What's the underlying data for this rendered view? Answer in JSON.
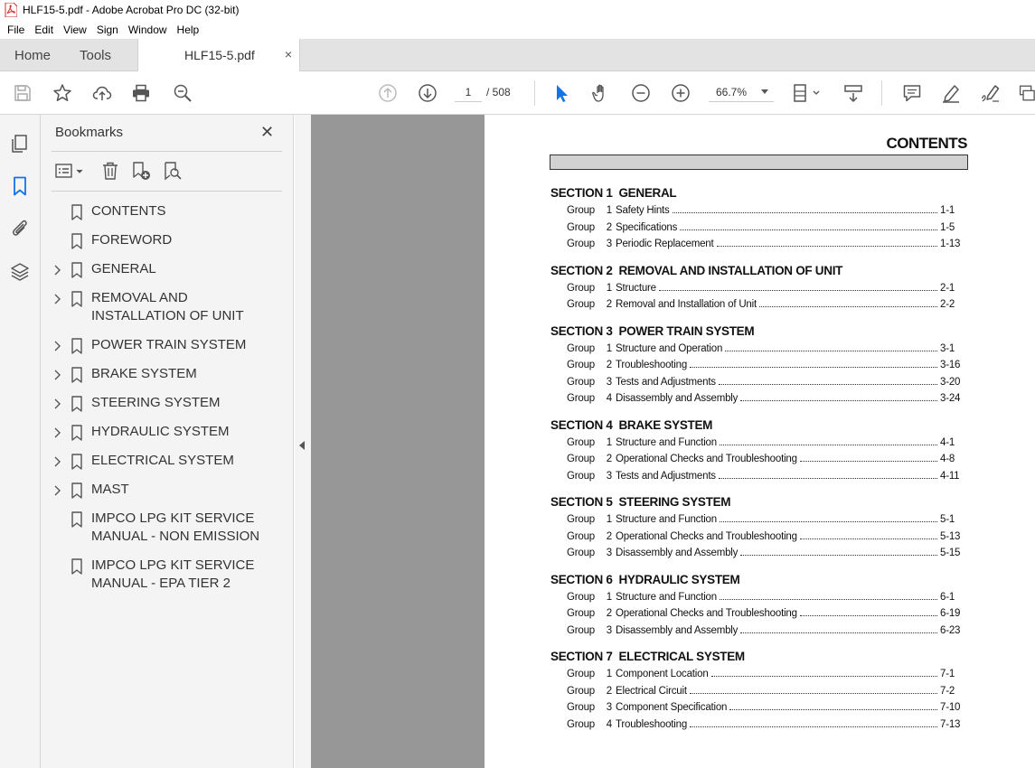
{
  "window": {
    "title": "HLF15-5.pdf - Adobe Acrobat Pro DC (32-bit)"
  },
  "menu": [
    "File",
    "Edit",
    "View",
    "Sign",
    "Window",
    "Help"
  ],
  "tabs": {
    "home": "Home",
    "tools": "Tools",
    "document": "HLF15-5.pdf",
    "close": "×"
  },
  "toolbar": {
    "page_current": "1",
    "page_total": "/ 508",
    "zoom": "66.7%"
  },
  "bookmarks": {
    "title": "Bookmarks",
    "close": "✕",
    "items": [
      {
        "label": "CONTENTS",
        "expandable": false
      },
      {
        "label": "FOREWORD",
        "expandable": false
      },
      {
        "label": "GENERAL",
        "expandable": true
      },
      {
        "label": "REMOVAL AND INSTALLATION OF UNIT",
        "expandable": true
      },
      {
        "label": "POWER TRAIN SYSTEM",
        "expandable": true
      },
      {
        "label": "BRAKE SYSTEM",
        "expandable": true
      },
      {
        "label": "STEERING SYSTEM",
        "expandable": true
      },
      {
        "label": "HYDRAULIC SYSTEM",
        "expandable": true
      },
      {
        "label": "ELECTRICAL SYSTEM",
        "expandable": true
      },
      {
        "label": "MAST",
        "expandable": true
      },
      {
        "label": "IMPCO LPG KIT SERVICE MANUAL - NON EMISSION",
        "expandable": false
      },
      {
        "label": "IMPCO LPG KIT SERVICE MANUAL - EPA TIER 2",
        "expandable": false
      }
    ]
  },
  "document": {
    "title": "CONTENTS",
    "sections": [
      {
        "heading": "SECTION 1  GENERAL",
        "groups": [
          {
            "group": "Group",
            "num": "1",
            "name": "Safety Hints",
            "page": "1-1"
          },
          {
            "group": "Group",
            "num": "2",
            "name": "Specifications",
            "page": "1-5"
          },
          {
            "group": "Group",
            "num": "3",
            "name": "Periodic Replacement",
            "page": "1-13"
          }
        ]
      },
      {
        "heading": "SECTION 2  REMOVAL AND INSTALLATION OF UNIT",
        "groups": [
          {
            "group": "Group",
            "num": "1",
            "name": "Structure",
            "page": "2-1"
          },
          {
            "group": "Group",
            "num": "2",
            "name": "Removal and Installation of Unit",
            "page": "2-2"
          }
        ]
      },
      {
        "heading": "SECTION 3  POWER TRAIN SYSTEM",
        "groups": [
          {
            "group": "Group",
            "num": "1",
            "name": "Structure and Operation",
            "page": "3-1"
          },
          {
            "group": "Group",
            "num": "2",
            "name": "Troubleshooting",
            "page": "3-16"
          },
          {
            "group": "Group",
            "num": "3",
            "name": "Tests and Adjustments",
            "page": "3-20"
          },
          {
            "group": "Group",
            "num": "4",
            "name": "Disassembly and Assembly",
            "page": "3-24"
          }
        ]
      },
      {
        "heading": "SECTION 4  BRAKE SYSTEM",
        "groups": [
          {
            "group": "Group",
            "num": "1",
            "name": "Structure and Function",
            "page": "4-1"
          },
          {
            "group": "Group",
            "num": "2",
            "name": "Operational Checks and Troubleshooting",
            "page": "4-8"
          },
          {
            "group": "Group",
            "num": "3",
            "name": "Tests and Adjustments",
            "page": "4-11"
          }
        ]
      },
      {
        "heading": "SECTION 5  STEERING SYSTEM",
        "groups": [
          {
            "group": "Group",
            "num": "1",
            "name": "Structure and Function",
            "page": "5-1"
          },
          {
            "group": "Group",
            "num": "2",
            "name": "Operational Checks and Troubleshooting",
            "page": "5-13"
          },
          {
            "group": "Group",
            "num": "3",
            "name": "Disassembly and Assembly",
            "page": "5-15"
          }
        ]
      },
      {
        "heading": "SECTION 6  HYDRAULIC SYSTEM",
        "groups": [
          {
            "group": "Group",
            "num": "1",
            "name": "Structure and Function",
            "page": "6-1"
          },
          {
            "group": "Group",
            "num": "2",
            "name": "Operational Checks and Troubleshooting",
            "page": "6-19"
          },
          {
            "group": "Group",
            "num": "3",
            "name": "Disassembly and Assembly",
            "page": "6-23"
          }
        ]
      },
      {
        "heading": "SECTION 7  ELECTRICAL SYSTEM",
        "groups": [
          {
            "group": "Group",
            "num": "1",
            "name": "Component Location",
            "page": "7-1"
          },
          {
            "group": "Group",
            "num": "2",
            "name": "Electrical Circuit",
            "page": "7-2"
          },
          {
            "group": "Group",
            "num": "3",
            "name": "Component Specification",
            "page": "7-10"
          },
          {
            "group": "Group",
            "num": "4",
            "name": "Troubleshooting",
            "page": "7-13"
          }
        ]
      }
    ]
  },
  "colors": {
    "accent_blue": "#1473e6",
    "app_red": "#d92b2b",
    "icon_gray": "#555555"
  }
}
